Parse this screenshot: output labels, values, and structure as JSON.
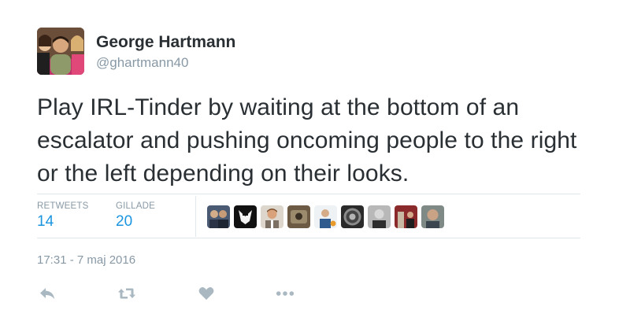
{
  "author": {
    "display_name": "George Hartmann",
    "screen_name": "@ghartmann40",
    "avatar_icon": "profile-photo"
  },
  "tweet": {
    "text": "Play IRL-Tinder by waiting at the bottom of an escalator and pushing oncoming people to the right or the left depending on their looks."
  },
  "stats": {
    "retweets_label": "RETWEETS",
    "retweets_count": "14",
    "likes_label": "GILLADE",
    "likes_count": "20"
  },
  "likers": [
    {
      "name": "liker-avatar",
      "bg": "#4a5a72"
    },
    {
      "name": "liker-avatar",
      "bg": "#111111"
    },
    {
      "name": "liker-avatar",
      "bg": "#c9c2b8"
    },
    {
      "name": "liker-avatar",
      "bg": "#6d5a45"
    },
    {
      "name": "liker-avatar",
      "bg": "#e9eef2"
    },
    {
      "name": "liker-avatar",
      "bg": "#3a3a3a"
    },
    {
      "name": "liker-avatar",
      "bg": "#9a9a9a"
    },
    {
      "name": "liker-avatar",
      "bg": "#8a2a2a"
    },
    {
      "name": "liker-avatar",
      "bg": "#7f8a86"
    }
  ],
  "timestamp": "17:31 - 7 maj 2016",
  "actions": {
    "reply_icon": "reply-icon",
    "retweet_icon": "retweet-icon",
    "like_icon": "heart-icon",
    "more_icon": "more-icon"
  },
  "colors": {
    "text": "#292f33",
    "secondary": "#8899a6",
    "link": "#1b95e0",
    "border": "#e1e8ed",
    "action_icon": "#aab8c2"
  }
}
